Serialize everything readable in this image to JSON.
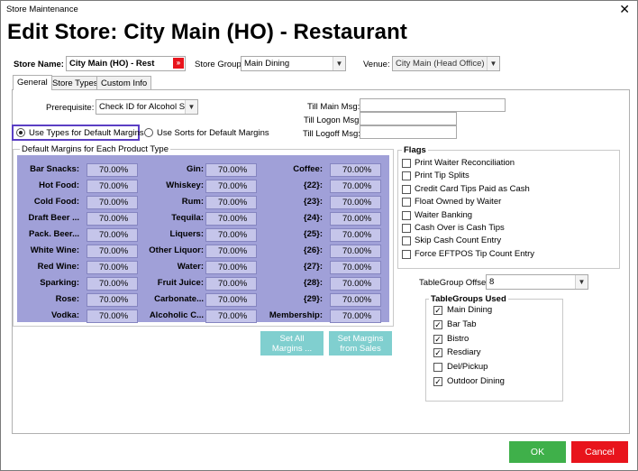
{
  "window": {
    "title": "Store  Maintenance",
    "close": "✕"
  },
  "heading": "Edit Store: City Main (HO) - Restaurant",
  "store": {
    "name_label": "Store Name:",
    "name_value": "City Main (HO) - Rest",
    "link_icon": "»",
    "group_label": "Store Group:",
    "group_value": "Main Dining",
    "venue_label": "Venue:",
    "venue_value": "City Main (Head Office)"
  },
  "tabs": [
    {
      "label": "General"
    },
    {
      "label": "Store Types"
    },
    {
      "label": "Custom Info"
    }
  ],
  "prerequisite": {
    "label": "Prerequisite:",
    "value": "Check ID for Alcohol Sa"
  },
  "till": {
    "main_label": "Till Main Msg:",
    "main_value": "",
    "logon_label": "Till Logon Msg:",
    "logon_value": "",
    "logoff_label": "Till Logoff Msg:",
    "logoff_value": ""
  },
  "radios": {
    "types": "Use Types for Default Margins",
    "sorts": "Use Sorts for Default Margins"
  },
  "margins": {
    "title": "Default Margins for Each Product Type",
    "col1": [
      {
        "label": "Bar Snacks:",
        "value": "70.00%"
      },
      {
        "label": "Hot Food:",
        "value": "70.00%"
      },
      {
        "label": "Cold Food:",
        "value": "70.00%"
      },
      {
        "label": "Draft Beer ...",
        "value": "70.00%"
      },
      {
        "label": "Pack. Beer...",
        "value": "70.00%"
      },
      {
        "label": "White Wine:",
        "value": "70.00%"
      },
      {
        "label": "Red Wine:",
        "value": "70.00%"
      },
      {
        "label": "Sparking:",
        "value": "70.00%"
      },
      {
        "label": "Rose:",
        "value": "70.00%"
      },
      {
        "label": "Vodka:",
        "value": "70.00%"
      }
    ],
    "col2": [
      {
        "label": "Gin:",
        "value": "70.00%"
      },
      {
        "label": "Whiskey:",
        "value": "70.00%"
      },
      {
        "label": "Rum:",
        "value": "70.00%"
      },
      {
        "label": "Tequila:",
        "value": "70.00%"
      },
      {
        "label": "Liquers:",
        "value": "70.00%"
      },
      {
        "label": "Other Liquor:",
        "value": "70.00%"
      },
      {
        "label": "Water:",
        "value": "70.00%"
      },
      {
        "label": "Fruit Juice:",
        "value": "70.00%"
      },
      {
        "label": "Carbonate...",
        "value": "70.00%"
      },
      {
        "label": "Alcoholic C...",
        "value": "70.00%"
      }
    ],
    "col3": [
      {
        "label": "Coffee:",
        "value": "70.00%"
      },
      {
        "label": "{22}:",
        "value": "70.00%"
      },
      {
        "label": "{23}:",
        "value": "70.00%"
      },
      {
        "label": "{24}:",
        "value": "70.00%"
      },
      {
        "label": "{25}:",
        "value": "70.00%"
      },
      {
        "label": "{26}:",
        "value": "70.00%"
      },
      {
        "label": "{27}:",
        "value": "70.00%"
      },
      {
        "label": "{28}:",
        "value": "70.00%"
      },
      {
        "label": "{29}:",
        "value": "70.00%"
      },
      {
        "label": "Membership:",
        "value": "70.00%"
      }
    ],
    "set_all_line1": "Set All",
    "set_all_line2": "Margins ...",
    "set_sales_line1": "Set Margins",
    "set_sales_line2": "from Sales"
  },
  "flags": {
    "title": "Flags",
    "items": [
      {
        "label": "Print Waiter Reconciliation"
      },
      {
        "label": "Print Tip Splits"
      },
      {
        "label": "Credit Card Tips Paid as Cash"
      },
      {
        "label": "Float Owned by Waiter"
      },
      {
        "label": "Waiter Banking"
      },
      {
        "label": "Cash Over is Cash Tips"
      },
      {
        "label": "Skip Cash Count Entry"
      },
      {
        "label": "Force EFTPOS Tip Count Entry"
      }
    ]
  },
  "tablegroup_offset": {
    "label": "TableGroup Offset:",
    "value": "8"
  },
  "tablegroups": {
    "title": "TableGroups Used",
    "items": [
      {
        "label": "Main Dining",
        "mark": "✓"
      },
      {
        "label": "Bar Tab",
        "mark": "✓"
      },
      {
        "label": "Bistro",
        "mark": "✓"
      },
      {
        "label": "Resdiary",
        "mark": "✓"
      },
      {
        "label": "Del/Pickup",
        "mark": ""
      },
      {
        "label": "Outdoor Dining",
        "mark": "✓"
      }
    ]
  },
  "buttons": {
    "ok": "OK",
    "cancel": "Cancel"
  },
  "colors": {
    "ok": "#3fb04a",
    "cancel": "#e8141c",
    "margins_panel": "#a0a0d8",
    "focus": "#5b3fc4",
    "secondary_buttons": "#80cfcf"
  }
}
